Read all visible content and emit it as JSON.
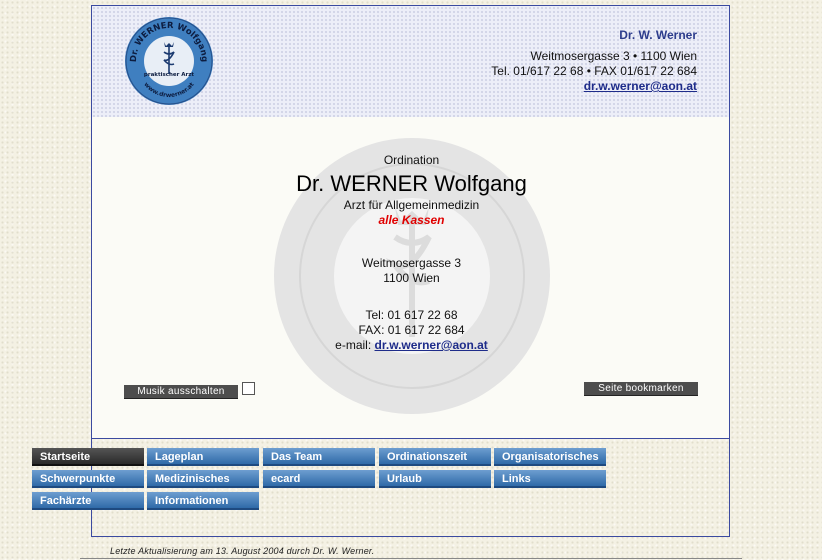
{
  "header": {
    "name": "Dr. W. Werner",
    "address": "Weitmosergasse 3 • 1100 Wien",
    "phone_fax": "Tel. 01/617 22 68 • FAX 01/617 22 684",
    "email": "dr.w.werner@aon.at",
    "logo": {
      "top_text": "Dr. WERNER Wolfgang",
      "middle_text": "praktischer Arzt",
      "bottom_text": "www.drwerner.at"
    }
  },
  "main": {
    "ordination": "Ordination",
    "doctor_name": "Dr. WERNER Wolfgang",
    "specialty": "Arzt für Allgemeinmedizin",
    "kassen": "alle Kassen",
    "street": "Weitmosergasse 3",
    "city": "1100 Wien",
    "tel": "Tel: 01 617 22 68",
    "fax": "FAX: 01 617 22 684",
    "email_label": "e-mail: ",
    "email": "dr.w.werner@aon.at",
    "music_button": "Musik ausschalten",
    "bookmark_button": "Seite bookmarken"
  },
  "nav": {
    "items": [
      {
        "label": "Startseite"
      },
      {
        "label": "Lageplan"
      },
      {
        "label": "Das Team"
      },
      {
        "label": "Ordinationszeit"
      },
      {
        "label": "Organisatorisches"
      },
      {
        "label": "Schwerpunkte"
      },
      {
        "label": "Medizinisches"
      },
      {
        "label": "ecard"
      },
      {
        "label": "Urlaub"
      },
      {
        "label": "Links"
      },
      {
        "label": "Fachärzte"
      },
      {
        "label": "Informationen"
      }
    ]
  },
  "footer": {
    "text": "Letzte Aktualisierung am 13. August 2004 durch Dr. W. Werner."
  },
  "colors": {
    "nav_blue": "#3f7cbf",
    "nav_active": "#3a3a3a",
    "frame_border": "#3b4aa0",
    "link": "#1e2c8a",
    "kassen_red": "#e00000"
  }
}
